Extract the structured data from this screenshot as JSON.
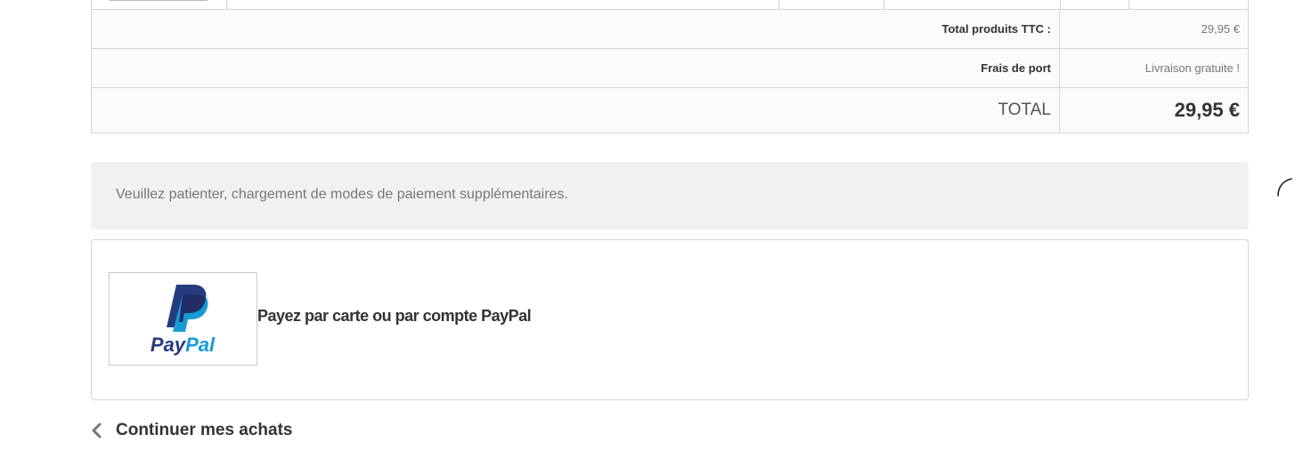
{
  "summary": {
    "rows": [
      {
        "label": "Total produits TTC :",
        "value": "29,95 €"
      },
      {
        "label": "Frais de port",
        "value": "Livraison gratuite !"
      }
    ],
    "total": {
      "label": "TOTAL",
      "value": "29,95 €"
    }
  },
  "loading": {
    "message": "Veuillez patienter, chargement de modes de paiement supplémentaires.",
    "icon": "spinner-icon"
  },
  "payment": {
    "option_label": "Payez par carte ou par compte PayPal",
    "logo_text": "PayPal",
    "colors": {
      "dark_blue": "#253b80",
      "light_blue": "#179bd7"
    }
  },
  "nav": {
    "continue_label": "Continuer mes achats",
    "icon": "chevron-left-icon"
  }
}
